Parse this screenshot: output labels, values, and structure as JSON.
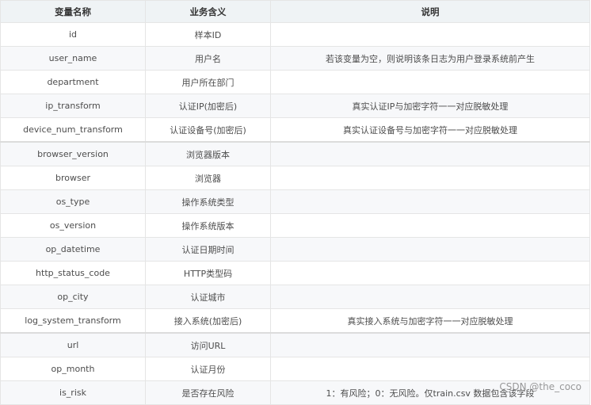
{
  "table": {
    "headers": [
      "变量名称",
      "业务含义",
      "说明"
    ],
    "rows": [
      {
        "name": "id",
        "meaning": "样本ID",
        "note": ""
      },
      {
        "name": "user_name",
        "meaning": "用户名",
        "note": "若该变量为空，则说明该条日志为用户登录系统前产生"
      },
      {
        "name": "department",
        "meaning": "用户所在部门",
        "note": ""
      },
      {
        "name": "ip_transform",
        "meaning": "认证IP(加密后)",
        "note": "真实认证IP与加密字符一一对应脱敏处理"
      },
      {
        "name": "device_num_transform",
        "meaning": "认证设备号(加密后)",
        "note": "真实认证设备号与加密字符一一对应脱敏处理"
      },
      {
        "name": "browser_version",
        "meaning": "浏览器版本",
        "note": ""
      },
      {
        "name": "browser",
        "meaning": "浏览器",
        "note": ""
      },
      {
        "name": "os_type",
        "meaning": "操作系统类型",
        "note": ""
      },
      {
        "name": "os_version",
        "meaning": "操作系统版本",
        "note": ""
      },
      {
        "name": "op_datetime",
        "meaning": "认证日期时间",
        "note": ""
      },
      {
        "name": "http_status_code",
        "meaning": "HTTP类型码",
        "note": ""
      },
      {
        "name": "op_city",
        "meaning": "认证城市",
        "note": ""
      },
      {
        "name": "log_system_transform",
        "meaning": "接入系统(加密后)",
        "note": "真实接入系统与加密字符一一对应脱敏处理"
      },
      {
        "name": "url",
        "meaning": "访问URL",
        "note": ""
      },
      {
        "name": "op_month",
        "meaning": "认证月份",
        "note": ""
      },
      {
        "name": "is_risk",
        "meaning": "是否存在风险",
        "note": "1：有风险；0：无风险。仅train.csv 数据包含该字段"
      }
    ]
  },
  "watermark": "CSDN @the_coco"
}
